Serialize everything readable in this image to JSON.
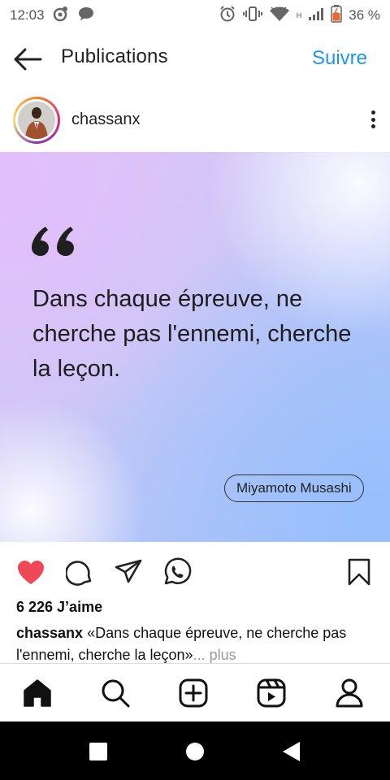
{
  "status_bar": {
    "time": "12:03",
    "network_type": "H",
    "battery_percent": "36 %"
  },
  "header": {
    "title": "Publications",
    "follow_label": "Suivre",
    "back_icon": "arrow-left-icon"
  },
  "post": {
    "username": "chassanx",
    "image": {
      "quote": "Dans chaque épreuve, ne cherche pas l'ennemi, cherche la leçon.",
      "author": "Miyamoto Musashi",
      "gradient_colors": [
        "#dfc6f8",
        "#cdc7f6",
        "#a9c4fb"
      ]
    },
    "actions": {
      "like_icon": "heart-filled-icon",
      "like_color": "#ed4956",
      "comment_icon": "comment-icon",
      "share_icon": "send-icon",
      "whatsapp_icon": "whatsapp-icon",
      "save_icon": "bookmark-icon"
    },
    "likes_text": "6 226 J’aime",
    "caption": {
      "username": "chassanx",
      "text": " «Dans chaque épreuve, ne cherche pas l'ennemi, cherche la leçon»",
      "more": "... plus"
    }
  },
  "bottom_nav": [
    "home-icon",
    "search-icon",
    "create-icon",
    "reels-icon",
    "profile-icon"
  ],
  "system_nav": [
    "recents-icon",
    "home-circle-icon",
    "back-triangle-icon"
  ],
  "colors": {
    "accent": "#1b95ef",
    "like": "#ed4956"
  }
}
